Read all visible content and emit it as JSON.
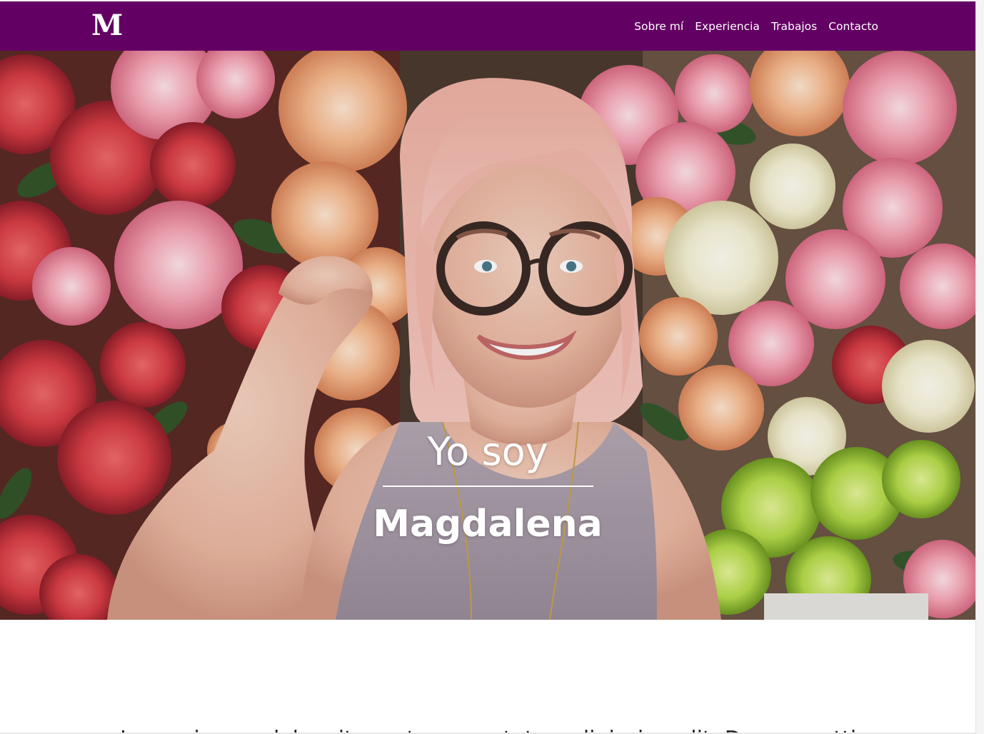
{
  "brand": {
    "logo_letter": "M",
    "color": "#630063"
  },
  "nav": {
    "items": [
      {
        "label": "Sobre mí"
      },
      {
        "label": "Experiencia"
      },
      {
        "label": "Trabajos"
      },
      {
        "label": "Contacto"
      }
    ]
  },
  "hero": {
    "pre_title": "Yo soy",
    "name": "Magdalena",
    "photo_icon": "portrait-with-flowers-photo"
  },
  "intro": {
    "text": "Lorem ipsum dolor sit amet, consectetur adipiscing elit. Donec mattis"
  }
}
